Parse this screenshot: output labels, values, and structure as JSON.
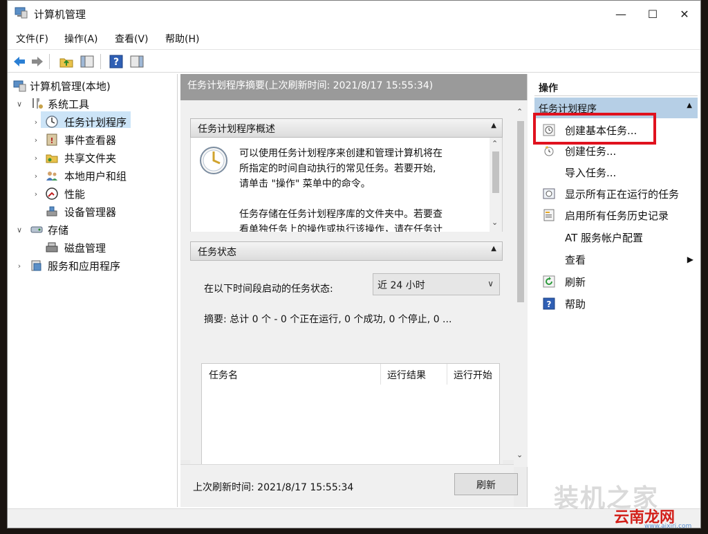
{
  "window": {
    "title": "计算机管理"
  },
  "window_controls": {
    "minimize": "—",
    "maximize": "☐",
    "close": "✕"
  },
  "menu": [
    "文件(F)",
    "操作(A)",
    "查看(V)",
    "帮助(H)"
  ],
  "tree": {
    "root": "计算机管理(本地)",
    "system_tools": "系统工具",
    "task_scheduler": "任务计划程序",
    "event_viewer": "事件查看器",
    "shared_folders": "共享文件夹",
    "local_users": "本地用户和组",
    "performance": "性能",
    "device_manager": "设备管理器",
    "storage": "存储",
    "disk_management": "磁盘管理",
    "services": "服务和应用程序"
  },
  "center": {
    "header": "任务计划程序摘要(上次刷新时间: 2021/8/17 15:55:34)",
    "overview_title": "任务计划程序概述",
    "overview_p1_l1": "可以使用任务计划程序来创建和管理计算机将在",
    "overview_p1_l2": "所指定的时间自动执行的常见任务。若要开始,",
    "overview_p1_l3": "请单击 \"操作\" 菜单中的命令。",
    "overview_p2_l1": "任务存储在任务计划程序库的文件夹中。若要查",
    "overview_p2_l2": "看单独任务上的操作或执行该操作，请在任务计",
    "status_title": "任务状态",
    "status_label": "在以下时间段启动的任务状态:",
    "status_select": "近 24 小时",
    "summary": "摘要: 总计 0 个 - 0 个正在运行, 0 个成功, 0 个停止, 0 ...",
    "columns": [
      "任务名",
      "运行结果",
      "运行开始"
    ],
    "last_refresh": "上次刷新时间: 2021/8/17 15:55:34",
    "refresh_button": "刷新"
  },
  "actions": {
    "title": "操作",
    "group": "任务计划程序",
    "items": [
      "创建基本任务...",
      "创建任务...",
      "导入任务...",
      "显示所有正在运行的任务",
      "启用所有任务历史记录",
      "AT 服务帐户配置",
      "查看",
      "刷新",
      "帮助"
    ]
  },
  "watermark": {
    "site": "装机之家",
    "brand": "云南龙网",
    "url": "www.aixiri.com"
  },
  "colors": {
    "highlight": "#e0121e",
    "selection": "#cce4f7",
    "group_bg": "#b6cfe6"
  }
}
